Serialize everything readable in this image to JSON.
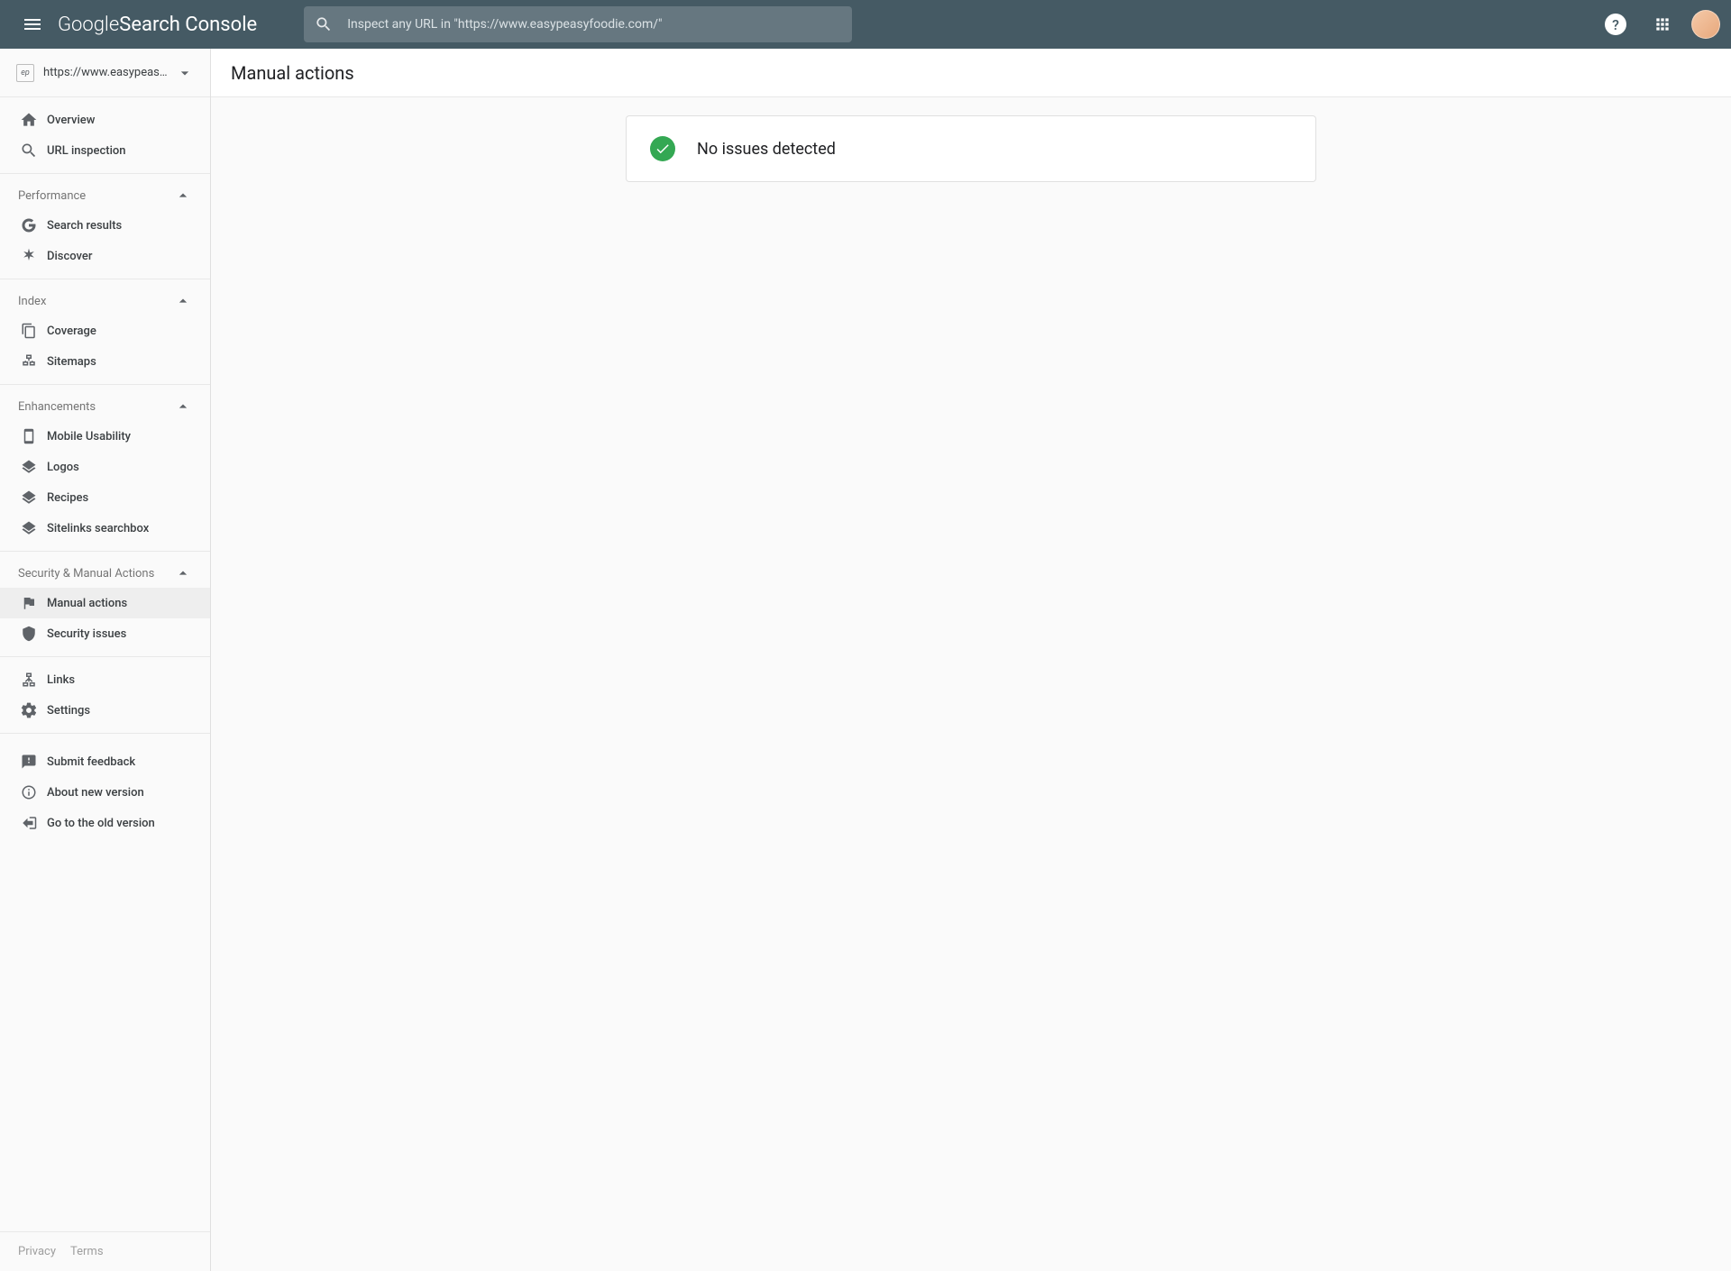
{
  "header": {
    "logo_thin": "Google ",
    "logo_rest": "Search Console",
    "search_placeholder": "Inspect any URL in \"https://www.easypeasyfoodie.com/\""
  },
  "property": {
    "label": "https://www.easypeasyfoodi..."
  },
  "sidebar": {
    "overview": "Overview",
    "url_inspection": "URL inspection",
    "performance_header": "Performance",
    "search_results": "Search results",
    "discover": "Discover",
    "index_header": "Index",
    "coverage": "Coverage",
    "sitemaps": "Sitemaps",
    "enhancements_header": "Enhancements",
    "mobile_usability": "Mobile Usability",
    "logos": "Logos",
    "recipes": "Recipes",
    "sitelinks": "Sitelinks searchbox",
    "security_header": "Security & Manual Actions",
    "manual_actions": "Manual actions",
    "security_issues": "Security issues",
    "links": "Links",
    "settings": "Settings",
    "submit_feedback": "Submit feedback",
    "about_new": "About new version",
    "go_old": "Go to the old version"
  },
  "footer": {
    "privacy": "Privacy",
    "terms": "Terms"
  },
  "main": {
    "page_title": "Manual actions",
    "status_text": "No issues detected"
  }
}
